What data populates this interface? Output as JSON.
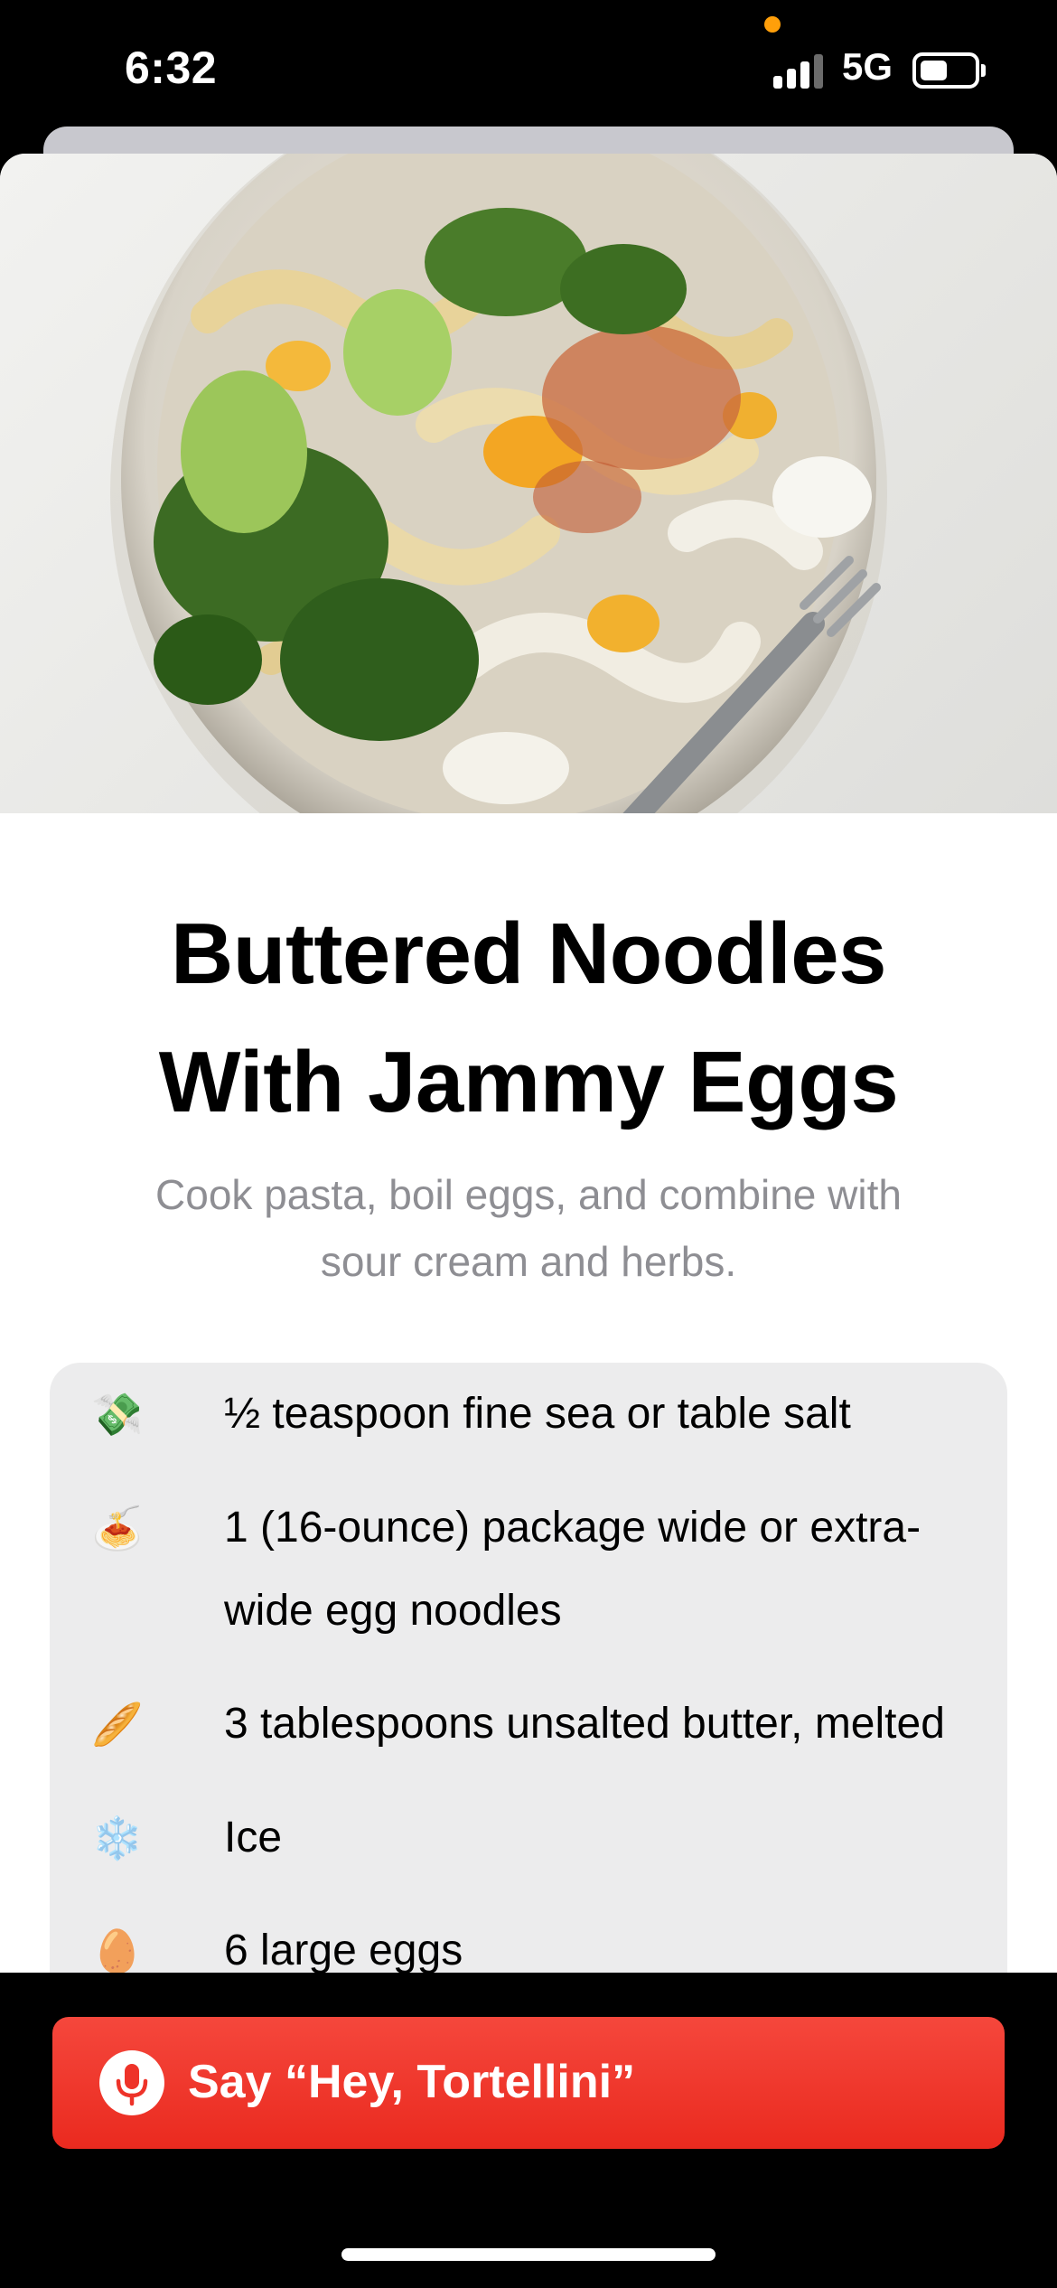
{
  "status_bar": {
    "time": "6:32",
    "network": "5G",
    "battery_level": 0.45
  },
  "recipe": {
    "photo_icon": "noodle-bowl-photo",
    "title_line1": "Buttered Noodles",
    "title_line2": "With Jammy Eggs",
    "description_line1": "Cook pasta, boil eggs, and combine with",
    "description_line2": "sour cream and herbs."
  },
  "ingredients": [
    {
      "emoji": "💸",
      "icon": "money-with-wings-icon",
      "line1": "½ teaspoon fine sea or table salt"
    },
    {
      "emoji": "🍝",
      "icon": "spaghetti-icon",
      "line1": "1 (16-ounce) package wide or extra-",
      "line2": "wide egg noodles"
    },
    {
      "emoji": "🥖",
      "icon": "baguette-icon",
      "line1": "3 tablespoons unsalted butter, melted"
    },
    {
      "emoji": "❄️",
      "icon": "snowflake-icon",
      "line1": "Ice"
    },
    {
      "emoji": "🥚",
      "icon": "egg-icon",
      "line1": "6 large eggs"
    }
  ],
  "voice_button": {
    "icon": "microphone-icon",
    "label": "Say “Hey, Tortellini”",
    "color": "#EE3329"
  }
}
